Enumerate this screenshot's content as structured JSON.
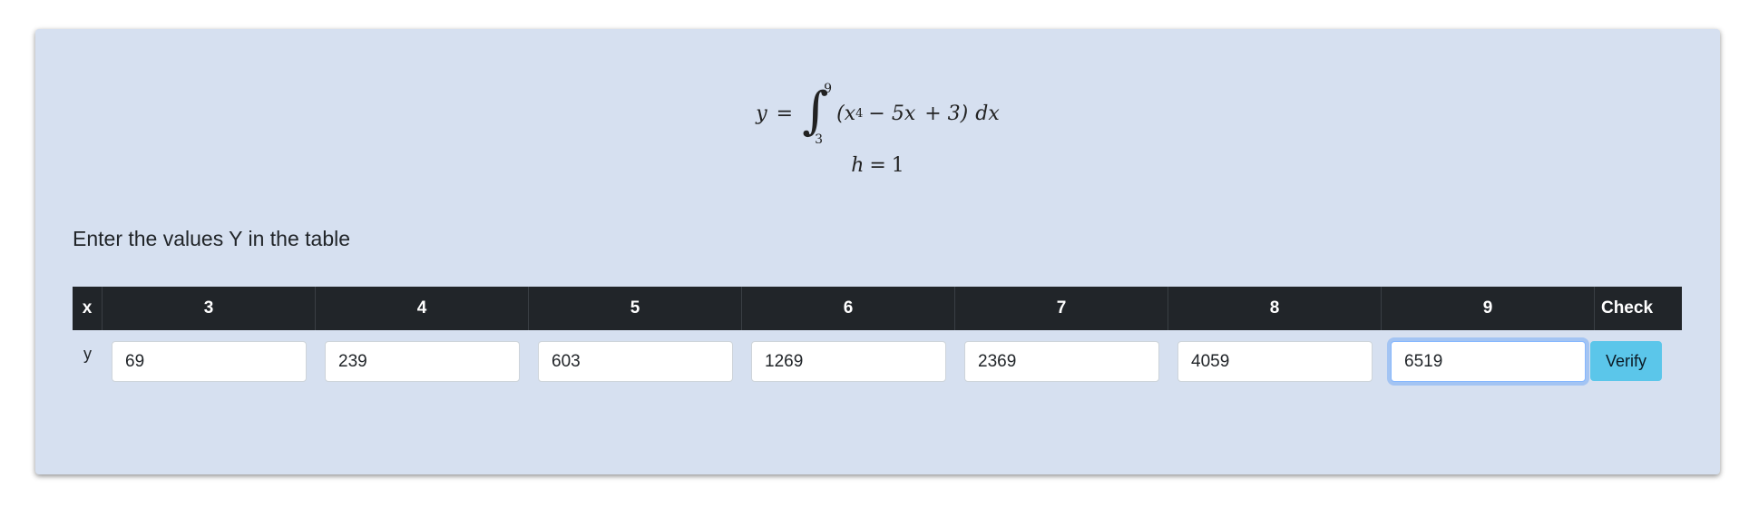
{
  "formula": {
    "lhs": "y",
    "equals": "=",
    "upper_limit": "9",
    "lower_limit": "3",
    "integrand_open": "(x",
    "power": "4",
    "term2": "− 5x",
    "term3": "+ 3)",
    "differential": "dx",
    "step_var": "h",
    "step_value": "1"
  },
  "instruction": "Enter the values Y in the table",
  "table": {
    "row_header": "x",
    "y_label": "y",
    "x_values": [
      "3",
      "4",
      "5",
      "6",
      "7",
      "8",
      "9"
    ],
    "check_header": "Check",
    "y_values": [
      "69",
      "239",
      "603",
      "1269",
      "2369",
      "4059",
      "6519"
    ],
    "focused_index": 6
  },
  "verify_label": "Verify",
  "colors": {
    "card_bg": "#d6e0f0",
    "header_bg": "#212529",
    "button_bg": "#5bc6ea",
    "focus_ring": "#86b7fe"
  }
}
